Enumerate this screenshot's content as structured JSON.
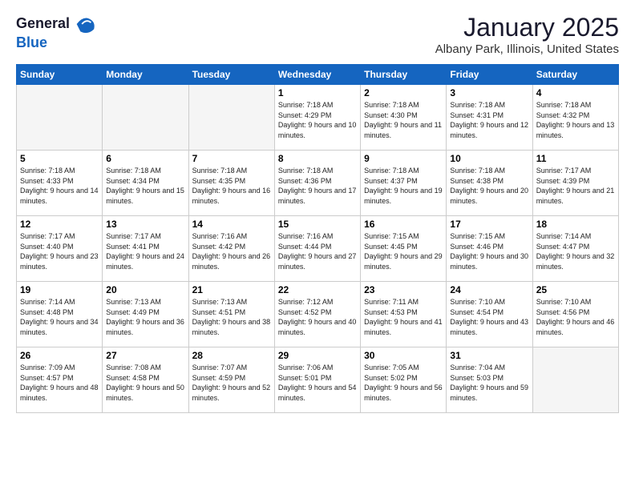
{
  "logo": {
    "general": "General",
    "blue": "Blue"
  },
  "title": "January 2025",
  "subtitle": "Albany Park, Illinois, United States",
  "days_of_week": [
    "Sunday",
    "Monday",
    "Tuesday",
    "Wednesday",
    "Thursday",
    "Friday",
    "Saturday"
  ],
  "weeks": [
    [
      {
        "day": "",
        "empty": true
      },
      {
        "day": "",
        "empty": true
      },
      {
        "day": "",
        "empty": true
      },
      {
        "day": "1",
        "sunrise": "7:18 AM",
        "sunset": "4:29 PM",
        "daylight": "9 hours and 10 minutes."
      },
      {
        "day": "2",
        "sunrise": "7:18 AM",
        "sunset": "4:30 PM",
        "daylight": "9 hours and 11 minutes."
      },
      {
        "day": "3",
        "sunrise": "7:18 AM",
        "sunset": "4:31 PM",
        "daylight": "9 hours and 12 minutes."
      },
      {
        "day": "4",
        "sunrise": "7:18 AM",
        "sunset": "4:32 PM",
        "daylight": "9 hours and 13 minutes."
      }
    ],
    [
      {
        "day": "5",
        "sunrise": "7:18 AM",
        "sunset": "4:33 PM",
        "daylight": "9 hours and 14 minutes."
      },
      {
        "day": "6",
        "sunrise": "7:18 AM",
        "sunset": "4:34 PM",
        "daylight": "9 hours and 15 minutes."
      },
      {
        "day": "7",
        "sunrise": "7:18 AM",
        "sunset": "4:35 PM",
        "daylight": "9 hours and 16 minutes."
      },
      {
        "day": "8",
        "sunrise": "7:18 AM",
        "sunset": "4:36 PM",
        "daylight": "9 hours and 17 minutes."
      },
      {
        "day": "9",
        "sunrise": "7:18 AM",
        "sunset": "4:37 PM",
        "daylight": "9 hours and 19 minutes."
      },
      {
        "day": "10",
        "sunrise": "7:18 AM",
        "sunset": "4:38 PM",
        "daylight": "9 hours and 20 minutes."
      },
      {
        "day": "11",
        "sunrise": "7:17 AM",
        "sunset": "4:39 PM",
        "daylight": "9 hours and 21 minutes."
      }
    ],
    [
      {
        "day": "12",
        "sunrise": "7:17 AM",
        "sunset": "4:40 PM",
        "daylight": "9 hours and 23 minutes."
      },
      {
        "day": "13",
        "sunrise": "7:17 AM",
        "sunset": "4:41 PM",
        "daylight": "9 hours and 24 minutes."
      },
      {
        "day": "14",
        "sunrise": "7:16 AM",
        "sunset": "4:42 PM",
        "daylight": "9 hours and 26 minutes."
      },
      {
        "day": "15",
        "sunrise": "7:16 AM",
        "sunset": "4:44 PM",
        "daylight": "9 hours and 27 minutes."
      },
      {
        "day": "16",
        "sunrise": "7:15 AM",
        "sunset": "4:45 PM",
        "daylight": "9 hours and 29 minutes."
      },
      {
        "day": "17",
        "sunrise": "7:15 AM",
        "sunset": "4:46 PM",
        "daylight": "9 hours and 30 minutes."
      },
      {
        "day": "18",
        "sunrise": "7:14 AM",
        "sunset": "4:47 PM",
        "daylight": "9 hours and 32 minutes."
      }
    ],
    [
      {
        "day": "19",
        "sunrise": "7:14 AM",
        "sunset": "4:48 PM",
        "daylight": "9 hours and 34 minutes."
      },
      {
        "day": "20",
        "sunrise": "7:13 AM",
        "sunset": "4:49 PM",
        "daylight": "9 hours and 36 minutes."
      },
      {
        "day": "21",
        "sunrise": "7:13 AM",
        "sunset": "4:51 PM",
        "daylight": "9 hours and 38 minutes."
      },
      {
        "day": "22",
        "sunrise": "7:12 AM",
        "sunset": "4:52 PM",
        "daylight": "9 hours and 40 minutes."
      },
      {
        "day": "23",
        "sunrise": "7:11 AM",
        "sunset": "4:53 PM",
        "daylight": "9 hours and 41 minutes."
      },
      {
        "day": "24",
        "sunrise": "7:10 AM",
        "sunset": "4:54 PM",
        "daylight": "9 hours and 43 minutes."
      },
      {
        "day": "25",
        "sunrise": "7:10 AM",
        "sunset": "4:56 PM",
        "daylight": "9 hours and 46 minutes."
      }
    ],
    [
      {
        "day": "26",
        "sunrise": "7:09 AM",
        "sunset": "4:57 PM",
        "daylight": "9 hours and 48 minutes."
      },
      {
        "day": "27",
        "sunrise": "7:08 AM",
        "sunset": "4:58 PM",
        "daylight": "9 hours and 50 minutes."
      },
      {
        "day": "28",
        "sunrise": "7:07 AM",
        "sunset": "4:59 PM",
        "daylight": "9 hours and 52 minutes."
      },
      {
        "day": "29",
        "sunrise": "7:06 AM",
        "sunset": "5:01 PM",
        "daylight": "9 hours and 54 minutes."
      },
      {
        "day": "30",
        "sunrise": "7:05 AM",
        "sunset": "5:02 PM",
        "daylight": "9 hours and 56 minutes."
      },
      {
        "day": "31",
        "sunrise": "7:04 AM",
        "sunset": "5:03 PM",
        "daylight": "9 hours and 59 minutes."
      },
      {
        "day": "",
        "empty": true
      }
    ]
  ]
}
